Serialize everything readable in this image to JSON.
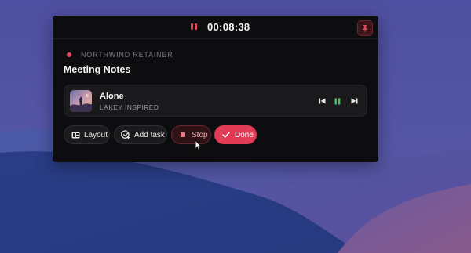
{
  "timer": {
    "elapsed": "00:08:38",
    "pause_icon": "pause-icon",
    "pin_icon": "pin-icon"
  },
  "project": {
    "name": "NORTHWIND RETAINER",
    "color": "#e14a5a"
  },
  "session": {
    "title": "Meeting Notes"
  },
  "music": {
    "track": "Alone",
    "artist": "LAKEY INSPIRED",
    "controls": {
      "prev_icon": "skip-previous-icon",
      "playpause_icon": "pause-icon",
      "next_icon": "skip-next-icon"
    }
  },
  "actions": {
    "layout_label": "Layout",
    "add_task_label": "Add task",
    "stop_label": "Stop",
    "done_label": "Done"
  },
  "colors": {
    "accent": "#e13b55",
    "play_accent": "#4cc46a",
    "panel": "#0d0d0f"
  }
}
